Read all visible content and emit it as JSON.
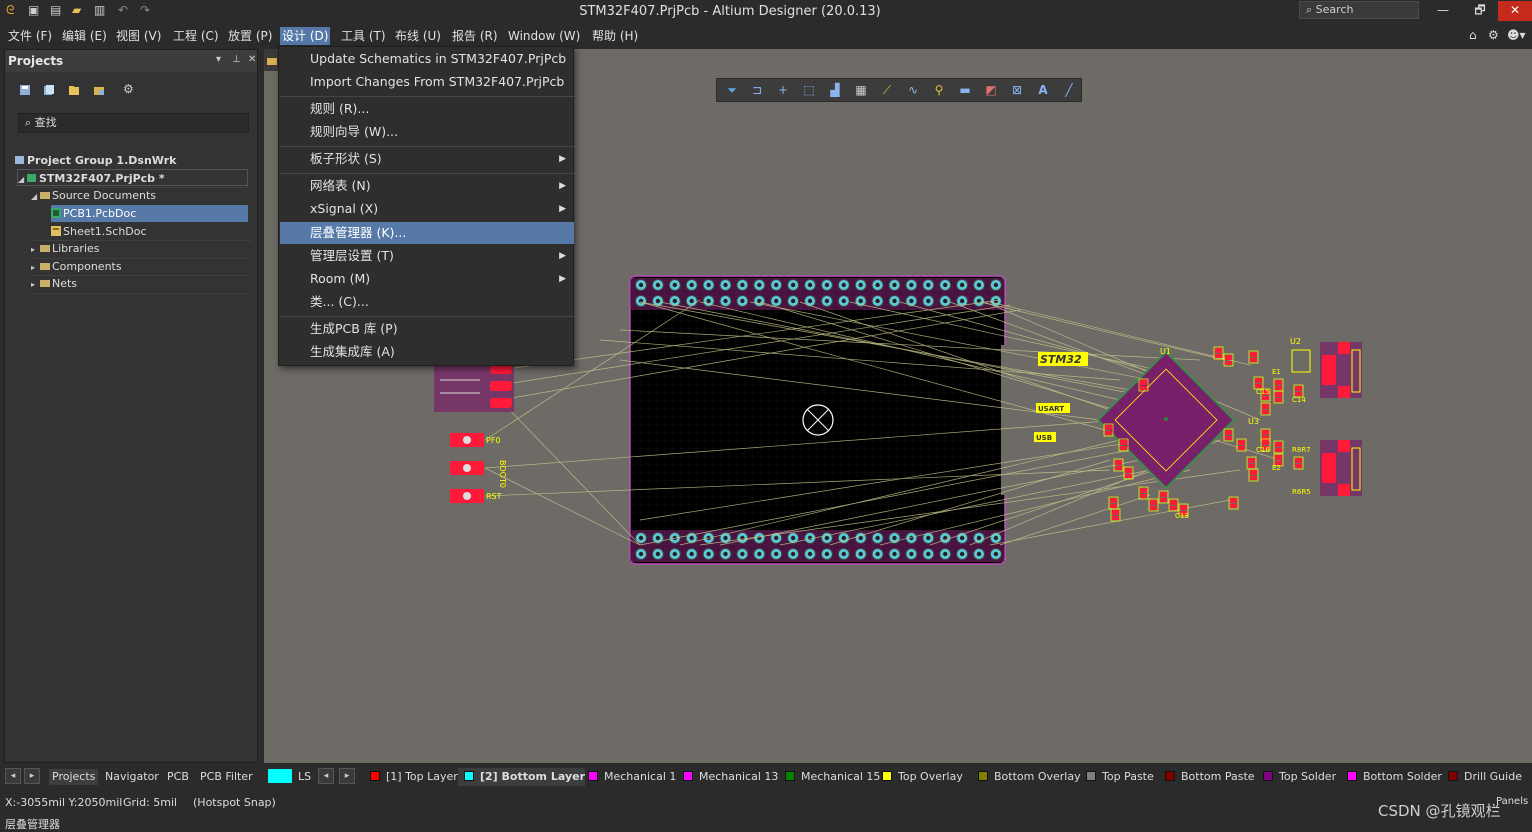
{
  "window": {
    "title": "STM32F407.PrjPcb - Altium Designer (20.0.13)",
    "search_placeholder": "Search",
    "minimize": "—",
    "restore": "🗗",
    "close": "✕"
  },
  "menubar": {
    "items": [
      {
        "label": "文件 (F)"
      },
      {
        "label": "编辑 (E)"
      },
      {
        "label": "视图 (V)"
      },
      {
        "label": "工程 (C)"
      },
      {
        "label": "放置 (P)"
      },
      {
        "label": "设计 (D)"
      },
      {
        "label": "工具 (T)"
      },
      {
        "label": "布线 (U)"
      },
      {
        "label": "报告 (R)"
      },
      {
        "label": "Window (W)"
      },
      {
        "label": "帮助 (H)"
      }
    ]
  },
  "projects_panel": {
    "title": "Projects",
    "search_placeholder": "查找",
    "tree": [
      {
        "label": "Project Group 1.DsnWrk"
      },
      {
        "label": "STM32F407.PrjPcb *"
      },
      {
        "label": "Source Documents"
      },
      {
        "label": "PCB1.PcbDoc"
      },
      {
        "label": "Sheet1.SchDoc"
      },
      {
        "label": "Libraries"
      },
      {
        "label": "Components"
      },
      {
        "label": "Nets"
      }
    ],
    "tabs": [
      "Projects",
      "Navigator",
      "PCB",
      "PCB Filter"
    ]
  },
  "design_menu": {
    "items": [
      {
        "label": "Update Schematics in STM32F407.PrjPcb"
      },
      {
        "label": "Import Changes From STM32F407.PrjPcb"
      },
      {
        "label": "规则 (R)..."
      },
      {
        "label": "规则向导 (W)..."
      },
      {
        "label": "板子形状 (S)"
      },
      {
        "label": "网络表 (N)"
      },
      {
        "label": "xSignal (X)"
      },
      {
        "label": "层叠管理器 (K)..."
      },
      {
        "label": "管理层设置 (T)"
      },
      {
        "label": "Room (M)"
      },
      {
        "label": "类... (C)..."
      },
      {
        "label": "生成PCB 库 (P)"
      },
      {
        "label": "生成集成库 (A)"
      }
    ]
  },
  "pcb": {
    "labels": {
      "stm32": "STM32",
      "usart": "USART",
      "usb": "USB",
      "u1": "U1",
      "u2": "U2",
      "u3": "U3",
      "pf0": "PF0",
      "boot0": "BOOT0",
      "rst": "RST",
      "c13": "C13",
      "c15": "C15",
      "c14": "C14",
      "c16": "C16",
      "e1": "E1",
      "e2": "E2",
      "r8r7": "R8R7",
      "r6r5": "R6R5"
    }
  },
  "layer_bar": {
    "ls": "LS",
    "layers": [
      {
        "label": "[1] Top Layer",
        "color": "#ff0000"
      },
      {
        "label": "[2] Bottom Layer",
        "color": "#00ffff"
      },
      {
        "label": "Mechanical 1",
        "color": "#ff00ff"
      },
      {
        "label": "Mechanical 13",
        "color": "#ff00ff"
      },
      {
        "label": "Mechanical 15",
        "color": "#008000"
      },
      {
        "label": "Top Overlay",
        "color": "#ffff00"
      },
      {
        "label": "Bottom Overlay",
        "color": "#808000"
      },
      {
        "label": "Top Paste",
        "color": "#808080"
      },
      {
        "label": "Bottom Paste",
        "color": "#800000"
      },
      {
        "label": "Top Solder",
        "color": "#800080"
      },
      {
        "label": "Bottom Solder",
        "color": "#ff00ff"
      },
      {
        "label": "Drill Guide",
        "color": "#800000"
      }
    ]
  },
  "status": {
    "coords": "X:-3055mil Y:2050mil",
    "grid": "Grid: 5mil",
    "snap": "(Hotspot Snap)",
    "message": "层叠管理器",
    "panels": "Panels",
    "watermark": "CSDN @孔镜观栏"
  }
}
